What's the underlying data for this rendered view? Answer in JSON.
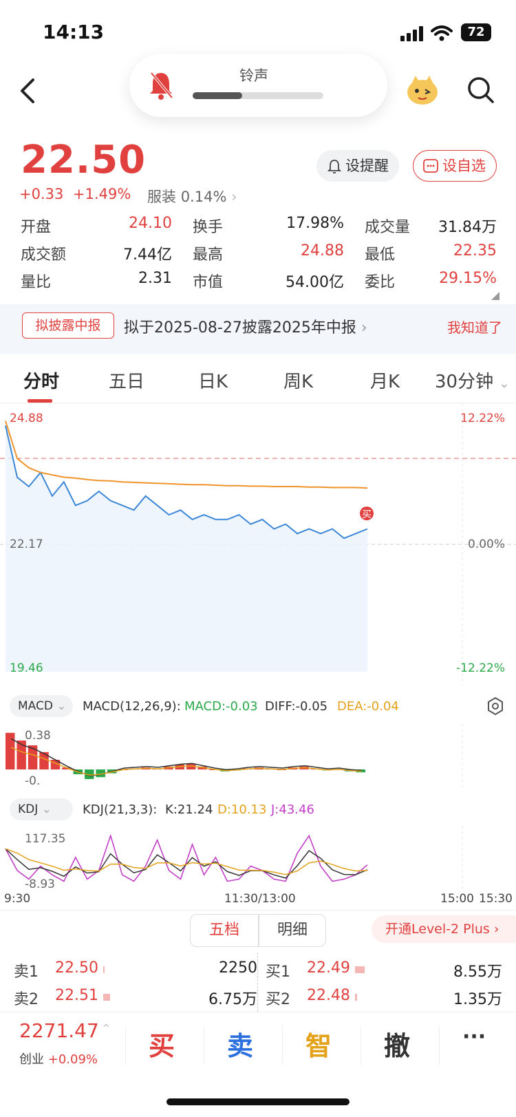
{
  "status": {
    "time": "14:13",
    "battery": "72"
  },
  "ringer": {
    "label": "铃声",
    "level": 0.38
  },
  "quote": {
    "price": "22.50",
    "change": "+0.33",
    "change_pct": "+1.49%",
    "sector_name": "服装",
    "sector_pct": "0.14%",
    "alert_label": "设提醒",
    "watch_label": "设自选"
  },
  "stats": {
    "open_label": "开盘",
    "open": "24.10",
    "turnover_label": "换手",
    "turnover": "17.98%",
    "volume_label": "成交量",
    "volume": "31.84万",
    "amount_label": "成交额",
    "amount": "7.44亿",
    "high_label": "最高",
    "high": "24.88",
    "low_label": "最低",
    "low": "22.35",
    "ratio_label": "量比",
    "ratio": "2.31",
    "mktcap_label": "市值",
    "mktcap": "54.00亿",
    "commit_label": "委比",
    "commit": "29.15%"
  },
  "notice": {
    "tag": "拟披露中报",
    "text": "拟于2025-08-27披露2025年中报",
    "dismiss": "我知道了"
  },
  "tabs": [
    "分时",
    "五日",
    "日K",
    "周K",
    "月K",
    "30分钟"
  ],
  "chart_data": {
    "type": "line",
    "title": "",
    "series": [
      {
        "name": "",
        "values": [
          24.7,
          23.6,
          23.4,
          23.7,
          23.2,
          23.5,
          23.0,
          23.1,
          23.3,
          23.1,
          23.0,
          22.9,
          23.2,
          23.0,
          22.8,
          22.9,
          22.7,
          22.8,
          22.7,
          22.7,
          22.8,
          22.6,
          22.7,
          22.5,
          22.6,
          22.4,
          22.5,
          22.4,
          22.5,
          22.3,
          22.4,
          22.5
        ]
      },
      {
        "name": "",
        "values": [
          24.8,
          24.0,
          23.8,
          23.7,
          23.65,
          23.6,
          23.58,
          23.55,
          23.53,
          23.52,
          23.5,
          23.49,
          23.48,
          23.47,
          23.46,
          23.45,
          23.44,
          23.44,
          23.43,
          23.42,
          23.42,
          23.41,
          23.41,
          23.4,
          23.4,
          23.4,
          23.39,
          23.39,
          23.38,
          23.38,
          23.38,
          23.37
        ]
      }
    ],
    "ylim": [
      19.46,
      24.88
    ],
    "y_ticks": [
      "24.88",
      "22.17",
      "19.46"
    ],
    "pct_ticks": [
      "12.22%",
      "0.00%",
      "-12.22%"
    ],
    "x_ticks": [
      "9:30",
      "11:30/13:00",
      "15:00",
      "15:30"
    ],
    "marker": "买"
  },
  "macd": {
    "selector": "MACD",
    "params": "MACD(12,26,9):",
    "macd": "MACD:-0.03",
    "diff": "DIFF:-0.05",
    "dea": "DEA:-0.04",
    "top_tick": "0.38",
    "bottom_tick": "-0.",
    "bars": [
      0.38,
      0.3,
      0.25,
      0.18,
      0.1,
      0.02,
      -0.05,
      -0.1,
      -0.08,
      -0.04,
      0.0,
      0.01,
      0.02,
      0.01,
      0.03,
      0.05,
      0.06,
      0.03,
      0.0,
      -0.02,
      -0.01,
      0.01,
      0.02,
      0.01,
      0.0,
      0.02,
      0.03,
      0.01,
      -0.01,
      0.0,
      -0.02,
      -0.03
    ]
  },
  "kdj": {
    "selector": "KDJ",
    "params": "KDJ(21,3,3):",
    "k": "K:21.24",
    "d": "D:10.13",
    "j": "J:43.46",
    "top_tick": "117.35",
    "bottom_tick": "-8.93",
    "j_values": [
      80,
      30,
      10,
      40,
      20,
      5,
      60,
      10,
      30,
      110,
      20,
      5,
      40,
      100,
      30,
      10,
      90,
      20,
      60,
      5,
      10,
      40,
      30,
      10,
      5,
      70,
      110,
      40,
      5,
      10,
      20,
      43
    ]
  },
  "orderbook": {
    "seg_5": "五档",
    "seg_detail": "明细",
    "level2": "开通Level-2 Plus",
    "asks": [
      {
        "label": "卖1",
        "price": "22.50",
        "vol": "2250"
      },
      {
        "label": "卖2",
        "price": "22.51",
        "vol": "6.75万"
      }
    ],
    "bids": [
      {
        "label": "买1",
        "price": "22.49",
        "vol": "8.55万"
      },
      {
        "label": "买2",
        "price": "22.48",
        "vol": "1.35万"
      }
    ]
  },
  "bottom": {
    "index_value": "2271.47",
    "index_name": "创业",
    "index_pct": "+0.09%",
    "buy": "买",
    "sell": "卖",
    "smart": "智",
    "cancel": "撤",
    "more": "···"
  }
}
